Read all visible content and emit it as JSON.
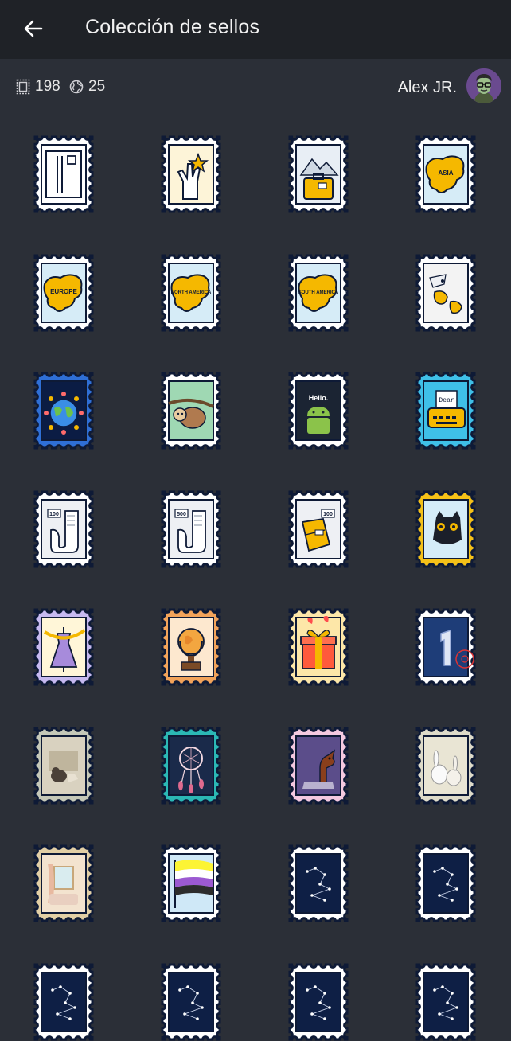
{
  "header": {
    "title": "Colección de sellos",
    "back_icon": "arrow-left-icon"
  },
  "stats": {
    "stamps_count": "198",
    "stamps_icon": "stamp-icon",
    "countries_count": "25",
    "countries_icon": "globe-icon",
    "user_name": "Alex JR."
  },
  "colors": {
    "topbar": "#1f2227",
    "background": "#2b2f37",
    "accent_yellow": "#f5b800",
    "stamp_border": "#0e1a36"
  },
  "stamps": [
    {
      "name": "stamp-postcard",
      "edge": "#ffffff",
      "bg": "#ffffff",
      "art": "postcard"
    },
    {
      "name": "stamp-victory-hand",
      "edge": "#ffffff",
      "bg": "#fdf4d8",
      "art": "hand"
    },
    {
      "name": "stamp-travel-suitcase",
      "edge": "#ffffff",
      "bg": "#e8eef5",
      "art": "suitcase"
    },
    {
      "name": "stamp-asia-map",
      "edge": "#ffffff",
      "bg": "#d6ecf7",
      "art": "map",
      "label": "ASIA"
    },
    {
      "name": "stamp-europe-map",
      "edge": "#ffffff",
      "bg": "#d6ecf7",
      "art": "map",
      "label": "EUROPE"
    },
    {
      "name": "stamp-north-america-map",
      "edge": "#ffffff",
      "bg": "#d6ecf7",
      "art": "map",
      "label": "NORTH AMERICA"
    },
    {
      "name": "stamp-south-america-map",
      "edge": "#ffffff",
      "bg": "#d6ecf7",
      "art": "map",
      "label": "SOUTH AMERICA"
    },
    {
      "name": "stamp-world-map",
      "edge": "#ffffff",
      "bg": "#f3f3f3",
      "art": "worldmap"
    },
    {
      "name": "stamp-world-unity",
      "edge": "#2f6fd6",
      "bg": "#0b1c44",
      "art": "globe"
    },
    {
      "name": "stamp-sloth",
      "edge": "#ffffff",
      "bg": "#9fd8b3",
      "art": "sloth"
    },
    {
      "name": "stamp-android-hello",
      "edge": "#ffffff",
      "bg": "#1b2433",
      "art": "android",
      "label": "Hello."
    },
    {
      "name": "stamp-typewriter-dear",
      "edge": "#3fc0e8",
      "bg": "#3fc0e8",
      "art": "typewriter",
      "label": "Dear"
    },
    {
      "name": "stamp-100-days",
      "edge": "#ffffff",
      "bg": "#eef0f4",
      "art": "scroll",
      "label": "100"
    },
    {
      "name": "stamp-500-days",
      "edge": "#ffffff",
      "bg": "#eef0f4",
      "art": "scroll",
      "label": "500"
    },
    {
      "name": "stamp-100-letters",
      "edge": "#ffffff",
      "bg": "#eef0f4",
      "art": "letters",
      "label": "100"
    },
    {
      "name": "stamp-black-cat",
      "edge": "#f5c118",
      "bg": "#d5ecf8",
      "art": "cat"
    },
    {
      "name": "stamp-dress-form",
      "edge": "#c6b9f0",
      "bg": "#fff6d8",
      "art": "dress"
    },
    {
      "name": "stamp-globe-trophy",
      "edge": "#f2a35a",
      "bg": "#fde8cf",
      "art": "trophy"
    },
    {
      "name": "stamp-gift",
      "edge": "#fde7a8",
      "bg": "#fde7a8",
      "art": "gift"
    },
    {
      "name": "stamp-number-one",
      "edge": "#ffffff",
      "bg": "#1e3d78",
      "art": "one"
    },
    {
      "name": "stamp-cat-painting",
      "edge": "#c5c8b8",
      "bg": "#d9d2c0",
      "art": "painting"
    },
    {
      "name": "stamp-dreamcatcher",
      "edge": "#2bb8b5",
      "bg": "#1a2a4a",
      "art": "dreamcatcher"
    },
    {
      "name": "stamp-dachshund",
      "edge": "#f4c9e0",
      "bg": "#5b4d8a",
      "art": "dog"
    },
    {
      "name": "stamp-bunnies",
      "edge": "#dedbc9",
      "bg": "#e9e5d4",
      "art": "bunnies"
    },
    {
      "name": "stamp-cozy-room",
      "edge": "#e2cfa5",
      "bg": "#f3e3cf",
      "art": "room"
    },
    {
      "name": "stamp-nonbinary-flag",
      "edge": "#ffffff",
      "bg": "#cfe8f7",
      "art": "flag"
    },
    {
      "name": "stamp-gemini-constellation",
      "edge": "#ffffff",
      "bg": "#0e1f45",
      "art": "constellation"
    },
    {
      "name": "stamp-pisces-constellation",
      "edge": "#ffffff",
      "bg": "#0e1f45",
      "art": "constellation"
    },
    {
      "name": "stamp-constellation-a",
      "edge": "#ffffff",
      "bg": "#0e1f45",
      "art": "constellation"
    },
    {
      "name": "stamp-constellation-b",
      "edge": "#ffffff",
      "bg": "#0e1f45",
      "art": "constellation"
    },
    {
      "name": "stamp-constellation-c",
      "edge": "#ffffff",
      "bg": "#0e1f45",
      "art": "constellation"
    },
    {
      "name": "stamp-constellation-d",
      "edge": "#ffffff",
      "bg": "#0e1f45",
      "art": "constellation"
    }
  ]
}
